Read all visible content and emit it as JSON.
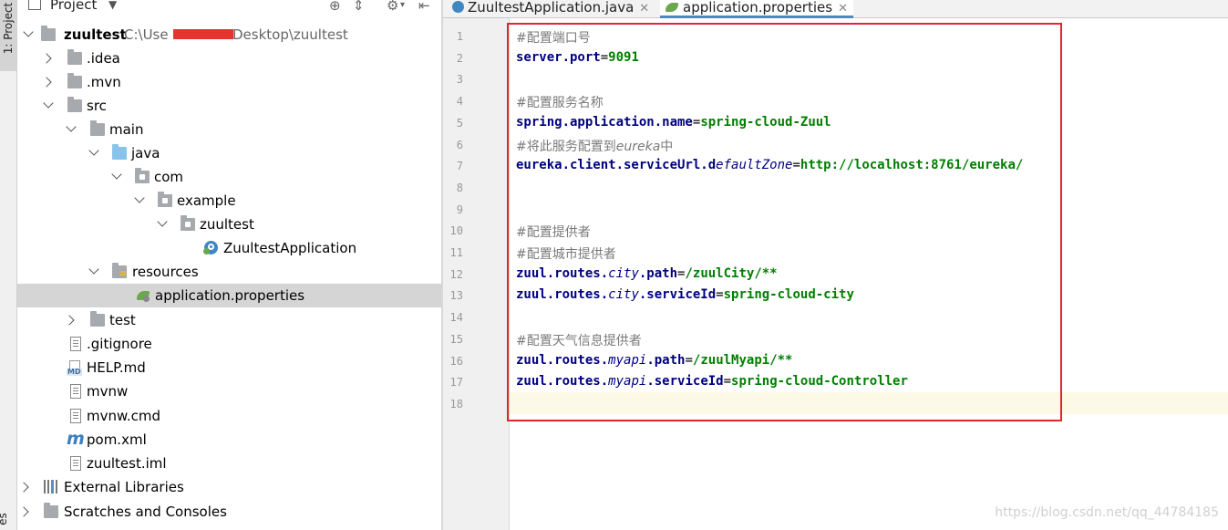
{
  "toolstrip": {
    "project_tab": "1: Project",
    "structure_tab": "es"
  },
  "project_panel": {
    "title": "Project",
    "tree": [
      {
        "label": "zuultest",
        "path": "C:\\Use",
        "path_end": "Desktop\\zuultest",
        "bold": true
      },
      {
        "label": ".idea"
      },
      {
        "label": ".mvn"
      },
      {
        "label": "src"
      },
      {
        "label": "main"
      },
      {
        "label": "java"
      },
      {
        "label": "com"
      },
      {
        "label": "example"
      },
      {
        "label": "zuultest"
      },
      {
        "label": "ZuultestApplication"
      },
      {
        "label": "resources"
      },
      {
        "label": "application.properties",
        "selected": true
      },
      {
        "label": "test"
      },
      {
        "label": ".gitignore"
      },
      {
        "label": "HELP.md"
      },
      {
        "label": "mvnw"
      },
      {
        "label": "mvnw.cmd"
      },
      {
        "label": "pom.xml"
      },
      {
        "label": "zuultest.iml"
      },
      {
        "label": "External Libraries"
      },
      {
        "label": "Scratches and Consoles"
      }
    ]
  },
  "editor": {
    "tabs": [
      {
        "label": "ZuultestApplication.java",
        "active": false
      },
      {
        "label": "application.properties",
        "active": true
      }
    ],
    "lines": [
      {
        "n": "1",
        "comment": "#配置端口号"
      },
      {
        "n": "2",
        "key": "server.port",
        "val": "9091"
      },
      {
        "n": "3"
      },
      {
        "n": "4",
        "comment": "#配置服务名称"
      },
      {
        "n": "5",
        "key": "spring.application.name",
        "val": "spring-cloud-Zuul"
      },
      {
        "n": "6",
        "comment": "#将此服务配置到",
        "comment_it": "eureka",
        "comment_end": "中"
      },
      {
        "n": "7",
        "key": "eureka.client.serviceUrl.d",
        "key_it": "efaultZone",
        "val": "http://localhost:8761/eureka/"
      },
      {
        "n": "8"
      },
      {
        "n": "9"
      },
      {
        "n": "10",
        "comment": "#配置提供者"
      },
      {
        "n": "11",
        "comment": "#配置城市提供者"
      },
      {
        "n": "12",
        "key": "zuul.routes.",
        "key_it": "city",
        "key_end": ".path",
        "val": "/zuulCity/**"
      },
      {
        "n": "13",
        "key": "zuul.routes.",
        "key_it": "city",
        "key_end": ".serviceId",
        "val": "spring-cloud-city"
      },
      {
        "n": "14"
      },
      {
        "n": "15",
        "comment": "#配置天气信息提供者"
      },
      {
        "n": "16",
        "key": "zuul.routes.",
        "key_it": "myapi",
        "key_end": ".path",
        "val": "/zuulMyapi/**"
      },
      {
        "n": "17",
        "key": "zuul.routes.",
        "key_it": "myapi",
        "key_end": ".serviceId",
        "val": "spring-cloud-Controller"
      },
      {
        "n": "18"
      }
    ]
  },
  "watermark": "https://blog.csdn.net/qq_44784185",
  "colors": {
    "selection": "#d5d5d5",
    "highlight_box": "#e3262d",
    "key": "#000080",
    "value": "#007f00",
    "comment": "#7a7a7a"
  }
}
